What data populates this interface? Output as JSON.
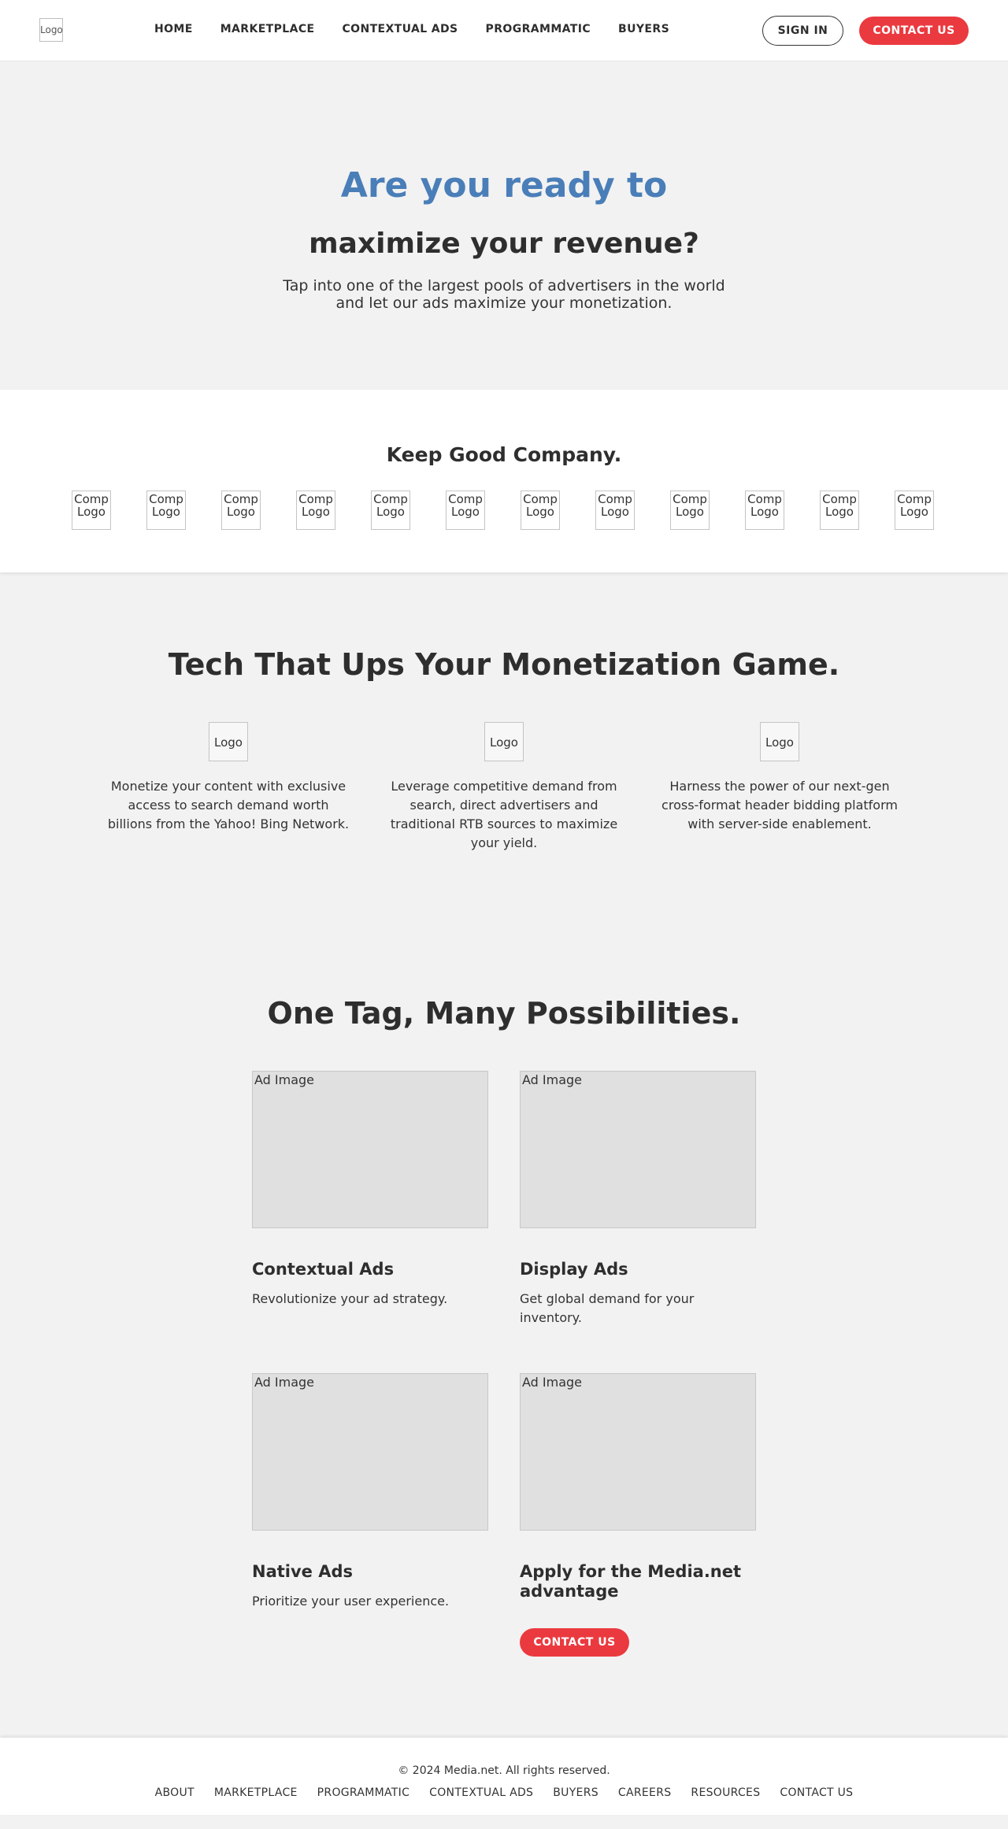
{
  "header": {
    "logo_alt": "Logo",
    "nav": [
      "HOME",
      "MARKETPLACE",
      "CONTEXTUAL ADS",
      "PROGRAMMATIC",
      "BUYERS"
    ],
    "sign_in": "SIGN IN",
    "contact": "CONTACT US"
  },
  "hero": {
    "title_line1": "Are you ready to",
    "title_line2": "maximize your revenue?",
    "subtitle": "Tap into one of the largest pools of advertisers in the world and let our ads maximize your monetization."
  },
  "company": {
    "heading": "Keep Good Company.",
    "logo_alt": "Comp Logo",
    "logo_count": 12
  },
  "tech": {
    "heading": "Tech That Ups Your Monetization Game.",
    "icon_alt": "Logo",
    "items": [
      {
        "text": "Monetize your content with exclusive access to search demand worth billions from the Yahoo! Bing Network."
      },
      {
        "text": "Leverage competitive demand from search, direct advertisers and traditional RTB sources to maximize your yield."
      },
      {
        "text": "Harness the power of our next-gen cross-format header bidding platform with server-side enablement."
      }
    ]
  },
  "possibilities": {
    "heading": "One Tag, Many Possibilities.",
    "image_alt": "Ad Image",
    "cards": [
      {
        "title": "Contextual Ads",
        "text": "Revolutionize your ad strategy."
      },
      {
        "title": "Display Ads",
        "text": "Get global demand for your inventory."
      },
      {
        "title": "Native Ads",
        "text": "Prioritize your user experience."
      },
      {
        "title": "Apply for the Media.net advantage",
        "button": "CONTACT US"
      }
    ]
  },
  "footer": {
    "copyright": "© 2024 Media.net. All rights reserved.",
    "links": [
      "ABOUT",
      "MARKETPLACE",
      "PROGRAMMATIC",
      "CONTEXTUAL ADS",
      "BUYERS",
      "CAREERS",
      "RESOURCES",
      "CONTACT US"
    ]
  }
}
